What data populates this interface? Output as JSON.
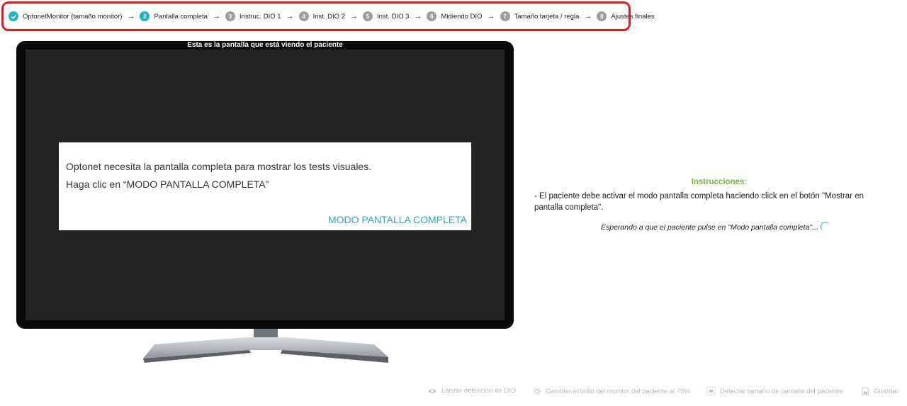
{
  "stepper": {
    "steps": [
      {
        "num": "",
        "label": "OptonetMonitor (tamaño monitor)",
        "state": "done"
      },
      {
        "num": "2",
        "label": "Pantalla completa",
        "state": "active"
      },
      {
        "num": "3",
        "label": "Instruc. DIO 1",
        "state": "pending"
      },
      {
        "num": "4",
        "label": "Inst. DIO 2",
        "state": "pending"
      },
      {
        "num": "5",
        "label": "Inst. DIO 3",
        "state": "pending"
      },
      {
        "num": "6",
        "label": "Midiendo DIO",
        "state": "pending"
      },
      {
        "num": "7",
        "label": "Tamaño tarjeta / regla",
        "state": "pending"
      },
      {
        "num": "8",
        "label": "Ajustes finales",
        "state": "pending"
      }
    ]
  },
  "monitor": {
    "caption": "Esta es la pantalla que está viendo el paciente",
    "dialog": {
      "line1": "Optonet necesita la pantalla completa para mostrar los tests visuales.",
      "line2": "Haga clic en “MODO PANTALLA COMPLETA”",
      "button": "MODO PANTALLA COMPLETA"
    }
  },
  "instructions": {
    "title": "Instrucciones:",
    "text": "- El paciente debe activar el modo pantalla completa haciendo click en el botón \"Mostrar en pantalla completa\".",
    "waiting": "Esperando a que el paciente pulse en \"Modo pantalla completa\"..."
  },
  "actions": {
    "detect_dio": "Lanzar detección de DIO",
    "brightness": "Cambiar el brillo del monitor del paciente al 70%",
    "detect_size": "Detectar tamaño de pantalla del paciente",
    "save": "Guardar"
  },
  "colors": {
    "accent": "#1fb3c8",
    "highlight_border": "#e21b1b",
    "instructions_title": "#7cb342",
    "disabled_text": "#b8b8b8"
  }
}
